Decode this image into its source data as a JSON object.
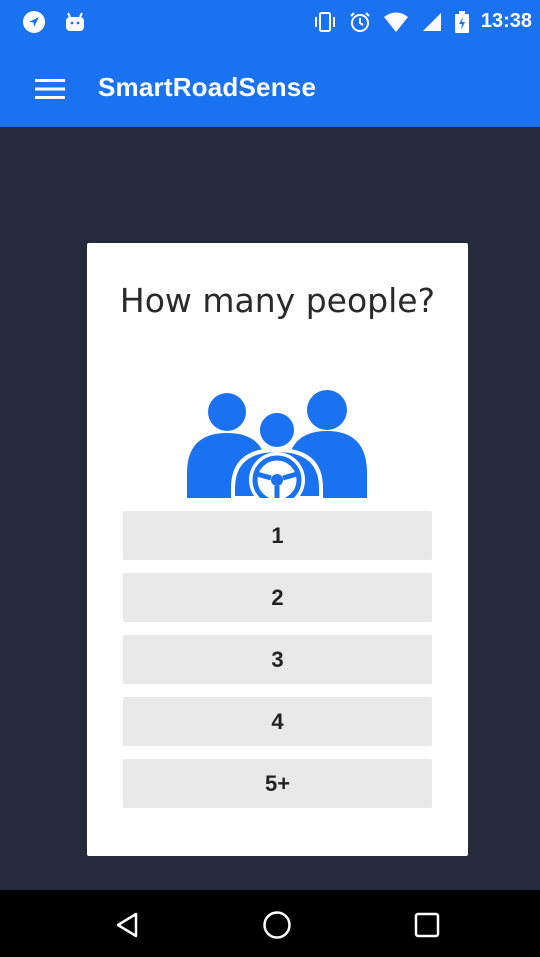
{
  "status_bar": {
    "time": "13:38",
    "icons_left": [
      "navigation-icon",
      "android-icon"
    ],
    "icons_right": [
      "vibrate-icon",
      "alarm-icon",
      "wifi-icon",
      "signal-icon",
      "battery-icon"
    ]
  },
  "app_bar": {
    "title": "SmartRoadSense",
    "background_color": "#1a72f0"
  },
  "dialog": {
    "question": "How many people?",
    "icon": "passengers-with-steering-wheel-icon",
    "icon_color": "#1a72f0",
    "options": [
      {
        "label": "1"
      },
      {
        "label": "2"
      },
      {
        "label": "3"
      },
      {
        "label": "4"
      },
      {
        "label": "5+"
      }
    ]
  },
  "nav_bar": {
    "buttons": [
      "back-icon",
      "home-icon",
      "recents-icon"
    ]
  }
}
